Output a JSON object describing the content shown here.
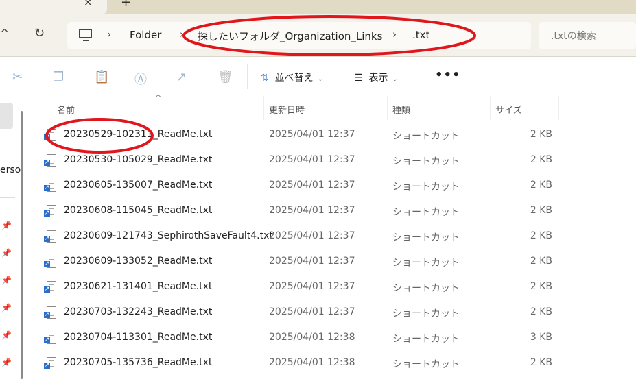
{
  "breadcrumb": {
    "items": [
      "Folder",
      "探したいフォルダ_Organization_Links",
      ".txt"
    ]
  },
  "search": {
    "placeholder": ".txtの検索"
  },
  "toolbar": {
    "sort_label": "並べ替え",
    "view_label": "表示",
    "more_label": "•••"
  },
  "sidebar": {
    "partial_text": "erso"
  },
  "columns": {
    "name": "名前",
    "date": "更新日時",
    "type": "種類",
    "size": "サイズ"
  },
  "files": [
    {
      "name": "20230529-102311_ReadMe.txt",
      "date": "2025/04/01 12:37",
      "type": "ショートカット",
      "size": "2 KB"
    },
    {
      "name": "20230530-105029_ReadMe.txt",
      "date": "2025/04/01 12:37",
      "type": "ショートカット",
      "size": "2 KB"
    },
    {
      "name": "20230605-135007_ReadMe.txt",
      "date": "2025/04/01 12:37",
      "type": "ショートカット",
      "size": "2 KB"
    },
    {
      "name": "20230608-115045_ReadMe.txt",
      "date": "2025/04/01 12:37",
      "type": "ショートカット",
      "size": "2 KB"
    },
    {
      "name": "20230609-121743_SephirothSaveFault4.txt",
      "date": "2025/04/01 12:37",
      "type": "ショートカット",
      "size": "2 KB"
    },
    {
      "name": "20230609-133052_ReadMe.txt",
      "date": "2025/04/01 12:37",
      "type": "ショートカット",
      "size": "2 KB"
    },
    {
      "name": "20230621-131401_ReadMe.txt",
      "date": "2025/04/01 12:37",
      "type": "ショートカット",
      "size": "2 KB"
    },
    {
      "name": "20230703-132243_ReadMe.txt",
      "date": "2025/04/01 12:37",
      "type": "ショートカット",
      "size": "2 KB"
    },
    {
      "name": "20230704-113301_ReadMe.txt",
      "date": "2025/04/01 12:38",
      "type": "ショートカット",
      "size": "3 KB"
    },
    {
      "name": "20230705-135736_ReadMe.txt",
      "date": "2025/04/01 12:38",
      "type": "ショートカット",
      "size": "2 KB"
    }
  ],
  "colors": {
    "annotation": "#e0161c",
    "tabstrip": "#e1dbc6",
    "navbar": "#f3f1ea"
  }
}
